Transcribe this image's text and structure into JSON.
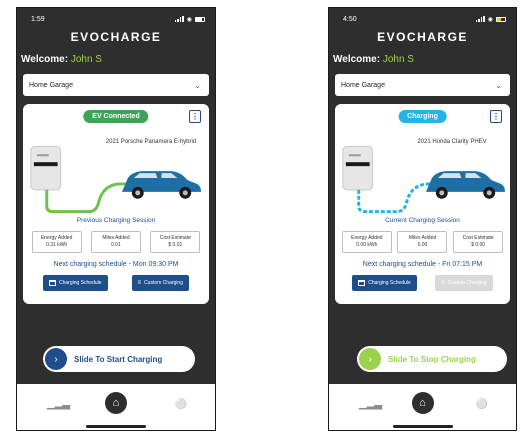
{
  "screens": [
    {
      "status_time": "1:59",
      "brand": "EVOCHARGE",
      "welcome_label": "Welcome:",
      "user_name": "John S",
      "location": "Home Garage",
      "badge": "EV Connected",
      "vehicle": "2021 Porsche Panamera E-hybrid",
      "session_title": "Previous Charging Session",
      "stats": [
        {
          "label": "Energy Added",
          "value": "0.31 kWh"
        },
        {
          "label": "Miles Added",
          "value": "0.01"
        },
        {
          "label": "Cost Estimate",
          "value": "$ 0.01"
        }
      ],
      "schedule": "Next charging schedule - Mon 09:30 PM",
      "action_schedule": "Charging Schedule",
      "action_custom": "Custom Charging",
      "slide": "Slide To Start Charging"
    },
    {
      "status_time": "4:50",
      "brand": "EVOCHARGE",
      "welcome_label": "Welcome:",
      "user_name": "John S",
      "location": "Home Garage",
      "badge": "Charging",
      "vehicle": "2021 Honda Clarity PHEV",
      "session_title": "Current Charging Session",
      "stats": [
        {
          "label": "Energy Added",
          "value": "0.00 kWh"
        },
        {
          "label": "Miles Added",
          "value": "0.00"
        },
        {
          "label": "Cost Estimate",
          "value": "$ 0.00"
        }
      ],
      "schedule": "Next charging schedule - Fri 07:15 PM",
      "action_schedule": "Charging Schedule",
      "action_custom": "Custom Charging",
      "slide": "Slide To Stop Charging"
    }
  ],
  "colors": {
    "background": "#2e2e2e",
    "brand_green": "#9bd24a",
    "badge_connected": "#3aa556",
    "badge_charging": "#25b3e8",
    "primary_blue": "#1f4e8c",
    "car_blue": "#1d6fa5"
  },
  "icons": {
    "status": [
      "location-arrow-icon",
      "signal-icon",
      "wifi-icon",
      "battery-icon"
    ],
    "tabs": [
      "stats-icon",
      "home-icon",
      "profile-icon"
    ],
    "slide": "chevron-right-icon"
  }
}
